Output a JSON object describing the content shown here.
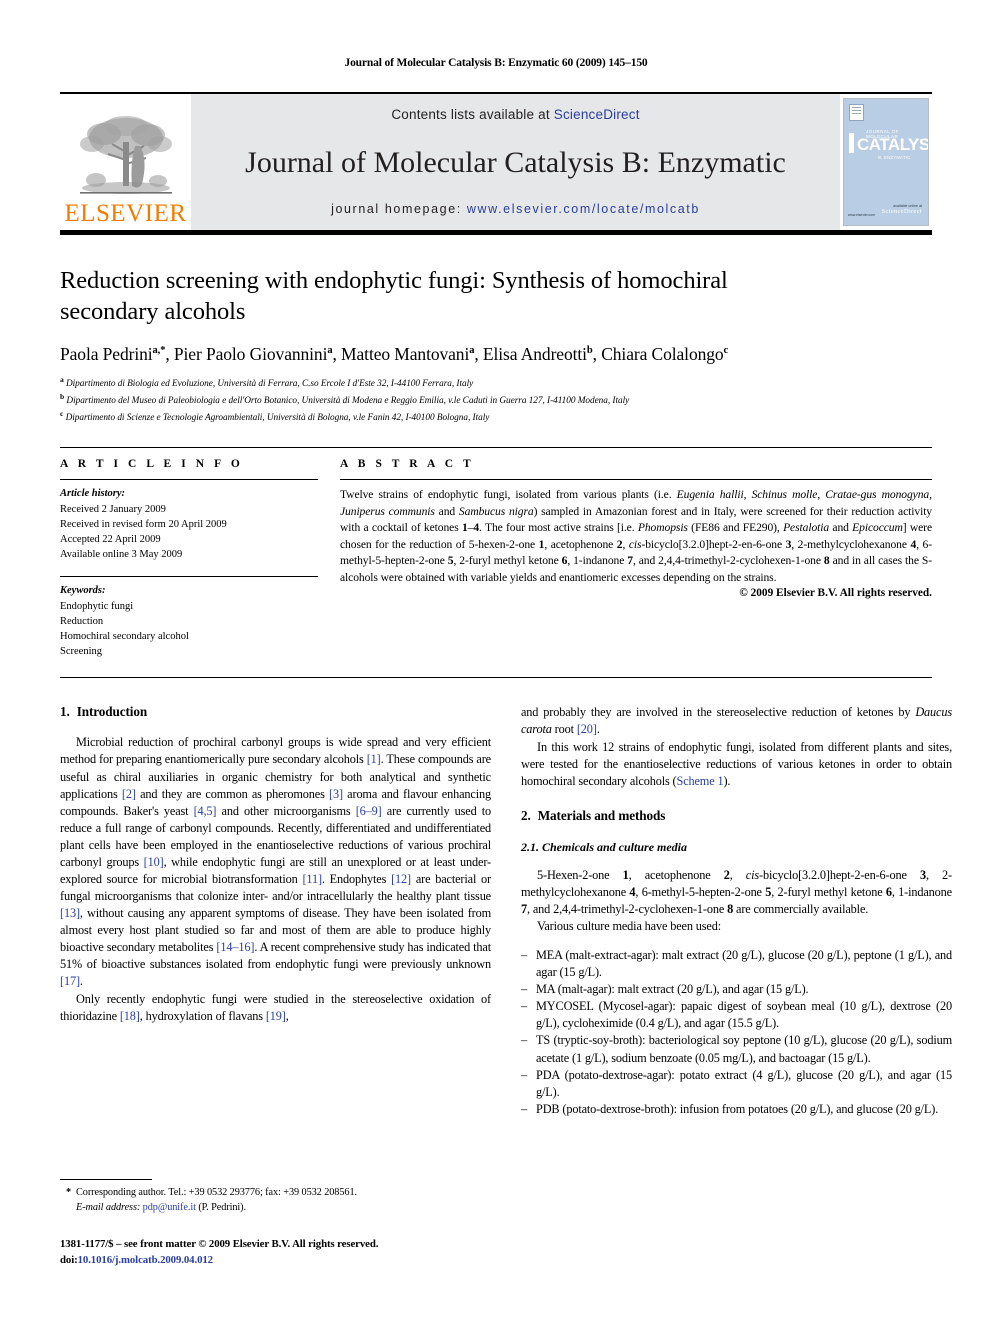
{
  "running_head": "Journal of Molecular Catalysis B: Enzymatic 60 (2009) 145–150",
  "masthead": {
    "publisher_name": "ELSEVIER",
    "contents_prefix": "Contents lists available at ",
    "contents_link": "ScienceDirect",
    "journal_title": "Journal of Molecular Catalysis B: Enzymatic",
    "homepage_prefix": "journal homepage: ",
    "homepage_url": "www.elsevier.com/locate/molcatb",
    "cover": {
      "line_small": "JOURNAL OF MOLECULAR",
      "line_big": "CATALYSIS",
      "line_sub": "B: ENZYMATIC",
      "bottom_right_small": "available online at",
      "bottom_right_brand": "ScienceDirect",
      "bottom_left": "www.elsevier.com"
    },
    "colors": {
      "link": "#2a3f9d",
      "elsevier_orange": "#f07d00",
      "panel_gray": "#e6e7e8",
      "cover_blue": "#b9cde4"
    }
  },
  "article": {
    "title": "Reduction screening with endophytic fungi: Synthesis of homochiral secondary alcohols",
    "authors_html": "Paola Pedrini<sup>a,*</sup>, Pier Paolo Giovannini<sup>a</sup>, Matteo Mantovani<sup>a</sup>, Elisa Andreotti<sup>b</sup>, Chiara Colalongo<sup>c</sup>",
    "affiliations": [
      {
        "marker": "a",
        "text": "Dipartimento di Biologia ed Evoluzione, Università di Ferrara, C.so Ercole I d'Este 32, I-44100 Ferrara, Italy"
      },
      {
        "marker": "b",
        "text": "Dipartimento del Museo di Paleobiologia e dell'Orto Botanico, Università di Modena e Reggio Emilia, v.le Caduti in Guerra 127, I-41100 Modena, Italy"
      },
      {
        "marker": "c",
        "text": "Dipartimento di Scienze e Tecnologie Agroambientali, Università di Bologna, v.le Fanin 42, I-40100 Bologna, Italy"
      }
    ]
  },
  "article_info": {
    "heading": "A R T I C L E   I N F O",
    "history_label": "Article history:",
    "history": [
      "Received 2 January 2009",
      "Received in revised form 20 April 2009",
      "Accepted 22 April 2009",
      "Available online 3 May 2009"
    ],
    "keywords_label": "Keywords:",
    "keywords": [
      "Endophytic fungi",
      "Reduction",
      "Homochiral secondary alcohol",
      "Screening"
    ]
  },
  "abstract": {
    "heading": "A B S T R A C T",
    "body_html": "Twelve strains of endophytic fungi, isolated from various plants (i.e. <i>Eugenia hallii</i>, <i>Schinus molle</i>, <i>Cratae-gus monogyna</i>, <i>Juniperus communis</i> and <i>Sambucus nigra</i>) sampled in Amazonian forest and in Italy, were screened for their reduction activity with a cocktail of ketones <b>1</b>–<b>4</b>. The four most active strains [i.e. <i>Phomopsis</i> (FE86 and FE290), <i>Pestalotia</i> and <i>Epicoccum</i>] were chosen for the reduction of 5-hexen-2-one <b>1</b>, acetophenone <b>2</b>, <i>cis</i>-bicyclo[3.2.0]hept-2-en-6-one <b>3</b>, 2-methylcyclohexanone <b>4</b>, 6-methyl-5-hepten-2-one <b>5</b>, 2-furyl methyl ketone <b>6</b>, 1-indanone <b>7</b>, and 2,4,4-trimethyl-2-cyclohexen-1-one <b>8</b> and in all cases the S-alcohols were obtained with variable yields and enantiomeric excesses depending on the strains.",
    "copyright": "© 2009 Elsevier B.V. All rights reserved."
  },
  "sections": {
    "introduction": {
      "number": "1.",
      "title": "Introduction",
      "paragraphs_html": [
        "Microbial reduction of prochiral carbonyl groups is wide spread and very efficient method for preparing enantiomerically pure secondary alcohols <span class=\"ref\">[1]</span>. These compounds are useful as chiral auxiliaries in organic chemistry for both analytical and synthetic applications <span class=\"ref\">[2]</span> and they are common as pheromones <span class=\"ref\">[3]</span> aroma and flavour enhancing compounds. Baker's yeast <span class=\"ref\">[4,5]</span> and other microorganisms <span class=\"ref\">[6–9]</span> are currently used to reduce a full range of carbonyl compounds. Recently, differentiated and undifferentiated plant cells have been employed in the enantioselective reductions of various prochiral carbonyl groups <span class=\"ref\">[10]</span>, while endophytic fungi are still an unexplored or at least under-explored source for microbial biotransformation <span class=\"ref\">[11]</span>. Endophytes <span class=\"ref\">[12]</span> are bacterial or fungal microorganisms that colonize inter- and/or intracellularly the healthy plant tissue <span class=\"ref\">[13]</span>, without causing any apparent symptoms of disease. They have been isolated from almost every host plant studied so far and most of them are able to produce highly bioactive secondary metabolites <span class=\"ref\">[14–16]</span>. A recent comprehensive study has indicated that 51% of bioactive substances isolated from endophytic fungi were previously unknown <span class=\"ref\">[17]</span>.",
        "Only recently endophytic fungi were studied in the stereoselective oxidation of thioridazine <span class=\"ref\">[18]</span>, hydroxylation of flavans <span class=\"ref\">[19]</span>, and probably they are involved in the stereoselective reduction of ketones by <i>Daucus carota</i> root <span class=\"ref\">[20]</span>.",
        "In this work 12 strains of endophytic fungi, isolated from different plants and sites, were tested for the enantioselective reductions of various ketones in order to obtain homochiral secondary alcohols (<span class=\"ref\">Scheme 1</span>)."
      ]
    },
    "materials": {
      "number": "2.",
      "title": "Materials and methods",
      "subsection": {
        "number": "2.1.",
        "title": "Chemicals and culture media",
        "paragraphs_html": [
          "5-Hexen-2-one <b>1</b>, acetophenone <b>2</b>, <i>cis</i>-bicyclo[3.2.0]hept-2-en-6-one <b>3</b>, 2-methylcyclohexanone <b>4</b>, 6-methyl-5-hepten-2-one <b>5</b>, 2-furyl methyl ketone <b>6</b>, 1-indanone <b>7</b>, and 2,4,4-trimethyl-2-cyclohexen-1-one <b>8</b> are commercially available.",
          "Various culture media have been used:"
        ],
        "media_list": [
          "MEA (malt-extract-agar): malt extract (20 g/L), glucose (20 g/L), peptone (1 g/L), and agar (15 g/L).",
          "MA (malt-agar): malt extract (20 g/L), and agar (15 g/L).",
          "MYCOSEL (Mycosel-agar): papaic digest of soybean meal (10 g/L), dextrose (20 g/L), cycloheximide (0.4 g/L), and agar (15.5 g/L).",
          "TS (tryptic-soy-broth): bacteriological soy peptone (10 g/L), glucose (20 g/L), sodium acetate (1 g/L), sodium benzoate (0.05 mg/L), and bactoagar (15 g/L).",
          "PDA (potato-dextrose-agar): potato extract (4 g/L), glucose (20 g/L), and agar (15 g/L).",
          "PDB (potato-dextrose-broth): infusion from potatoes (20 g/L), and glucose (20 g/L)."
        ]
      }
    }
  },
  "footnotes": {
    "corresponding_star": "*",
    "corresponding_text": "Corresponding author. Tel.: +39 0532 293776; fax: +39 0532 208561.",
    "email_label": "E-mail address:",
    "email": "pdp@unife.it",
    "email_suffix": "(P. Pedrini).",
    "issn_line": "1381-1177/$ – see front matter © 2009 Elsevier B.V. All rights reserved.",
    "doi_prefix": "doi:",
    "doi": "10.1016/j.molcatb.2009.04.012"
  }
}
